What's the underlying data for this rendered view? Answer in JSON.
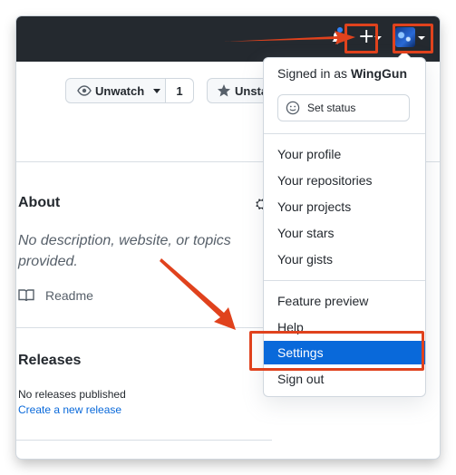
{
  "header": {
    "icons": [
      "bell-icon",
      "plus-icon",
      "caret-down-icon",
      "avatar"
    ],
    "plus_glyph": "+"
  },
  "repo_actions": {
    "watch_label": "Unwatch",
    "watch_count": "1",
    "star_label": "Unsta"
  },
  "about": {
    "title": "About",
    "description": "No description, website, or topics provided.",
    "readme_label": "Readme"
  },
  "releases": {
    "title": "Releases",
    "empty_text": "No releases published",
    "create_link": "Create a new release"
  },
  "user_menu": {
    "signed_in_prefix": "Signed in as ",
    "username": "WingGun",
    "set_status_label": "Set status",
    "items": [
      {
        "label": "Your profile"
      },
      {
        "label": "Your repositories"
      },
      {
        "label": "Your projects"
      },
      {
        "label": "Your stars"
      },
      {
        "label": "Your gists"
      },
      {
        "label": "Feature preview"
      },
      {
        "label": "Help"
      },
      {
        "label": "Settings",
        "active": true
      },
      {
        "label": "Sign out"
      }
    ]
  },
  "colors": {
    "header_bg": "#24292f",
    "accent": "#0969da",
    "annotation": "#e0421d"
  }
}
